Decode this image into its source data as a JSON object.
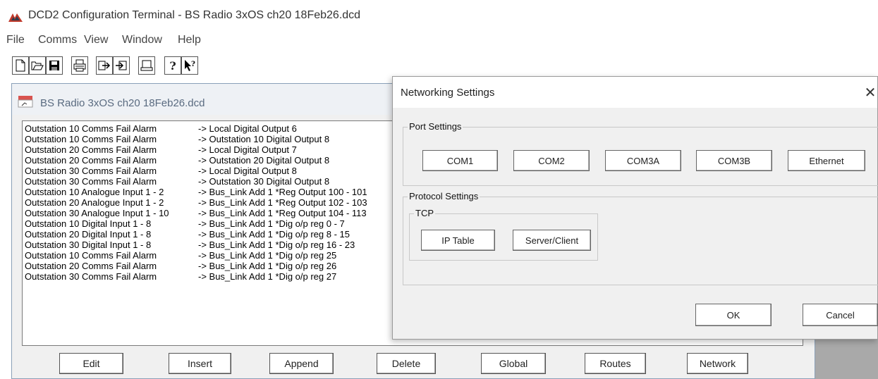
{
  "app": {
    "title": "DCD2 Configuration Terminal - BS Radio 3xOS ch20 18Feb26.dcd",
    "icon": "app-logo-icon"
  },
  "menu": [
    "File",
    "Comms",
    "View",
    "Window",
    "Help"
  ],
  "toolbar": {
    "icons": [
      "new-file-icon",
      "open-file-icon",
      "save-icon",
      "print-icon",
      "upload-icon",
      "download-icon",
      "terminal-icon",
      "help-icon",
      "context-help-icon"
    ]
  },
  "child_window": {
    "title": "BS Radio 3xOS ch20 18Feb26.dcd",
    "routes": [
      {
        "src": "Outstation 10 Comms Fail Alarm",
        "dst": "-> Local Digital Output 6"
      },
      {
        "src": "Outstation 10 Comms Fail Alarm",
        "dst": "-> Outstation 10 Digital Output 8"
      },
      {
        "src": "Outstation 20 Comms Fail Alarm",
        "dst": "-> Local Digital Output 7"
      },
      {
        "src": "Outstation 20 Comms Fail Alarm",
        "dst": "-> Outstation 20 Digital Output 8"
      },
      {
        "src": "Outstation 30 Comms Fail Alarm",
        "dst": "-> Local Digital Output 8"
      },
      {
        "src": "Outstation 30 Comms Fail Alarm",
        "dst": "-> Outstation 30 Digital Output 8"
      },
      {
        "src": "Outstation 10 Analogue Input 1 - 2",
        "dst": "-> Bus_Link Add 1 *Reg Output 100 - 101"
      },
      {
        "src": "Outstation 20 Analogue Input 1 - 2",
        "dst": "-> Bus_Link Add 1 *Reg Output 102 - 103"
      },
      {
        "src": "Outstation 30 Analogue Input 1 - 10",
        "dst": "-> Bus_Link Add 1 *Reg Output 104 - 113"
      },
      {
        "src": "Outstation 10 Digital Input 1 - 8",
        "dst": "-> Bus_Link Add 1 *Dig o/p reg 0 - 7"
      },
      {
        "src": "Outstation 20 Digital Input 1 - 8",
        "dst": "-> Bus_Link Add 1 *Dig o/p reg 8 - 15"
      },
      {
        "src": "Outstation 30 Digital Input 1 - 8",
        "dst": "-> Bus_Link Add 1 *Dig o/p reg 16 - 23"
      },
      {
        "src": "Outstation 10 Comms Fail Alarm",
        "dst": "-> Bus_Link Add 1 *Dig o/p reg 25"
      },
      {
        "src": "Outstation 20 Comms Fail Alarm",
        "dst": "-> Bus_Link Add 1 *Dig o/p reg 26"
      },
      {
        "src": "Outstation 30 Comms Fail Alarm",
        "dst": "-> Bus_Link Add 1 *Dig o/p reg 27"
      }
    ],
    "buttons": {
      "edit": "Edit",
      "insert": "Insert",
      "append": "Append",
      "delete": "Delete",
      "global": "Global",
      "routes": "Routes",
      "network": "Network"
    }
  },
  "dialog": {
    "title": "Networking Settings",
    "close": "✕",
    "port_group": "Port Settings",
    "ports": [
      "COM1",
      "COM2",
      "COM3A",
      "COM3B",
      "Ethernet"
    ],
    "protocol_group": "Protocol Settings",
    "tcp_group": "TCP",
    "tcp_buttons": {
      "ip_table": "IP Table",
      "server_client": "Server/Client"
    },
    "ok": "OK",
    "cancel": "Cancel"
  },
  "colors": {
    "mdi_background": "#a9a9a9",
    "dialog_background": "#f0f0f0"
  }
}
